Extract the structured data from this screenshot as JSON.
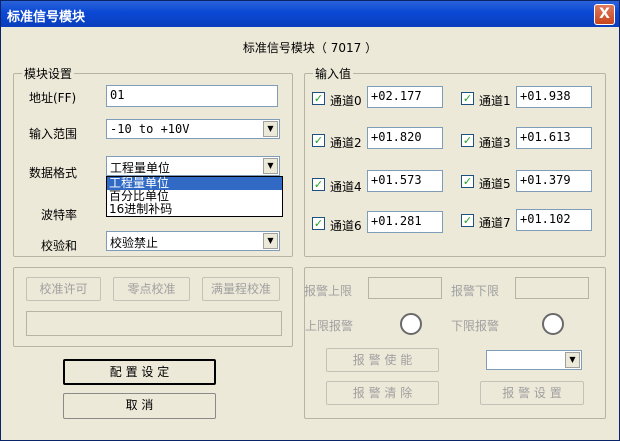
{
  "window": {
    "title": "标准信号模块",
    "close_glyph": "X"
  },
  "header": {
    "text": "标准信号模块（ 7017  ）"
  },
  "module_settings": {
    "legend": "模块设置",
    "address_label": "地址(FF)",
    "address_value": "01",
    "input_range_label": "输入范围",
    "input_range_value": "-10 to +10V",
    "data_format_label": "数据格式",
    "data_format_value": "工程量单位",
    "data_format_options": [
      "工程量单位",
      "百分比单位",
      "16进制补码"
    ],
    "baud_rate_label": "波特率",
    "checksum_label": "校验和",
    "checksum_value": "校验禁止"
  },
  "input_values": {
    "legend": "输入值",
    "channels": [
      {
        "label": "通道0",
        "value": "+02.177",
        "checked": true
      },
      {
        "label": "通道1",
        "value": "+01.938",
        "checked": true
      },
      {
        "label": "通道2",
        "value": "+01.820",
        "checked": true
      },
      {
        "label": "通道3",
        "value": "+01.613",
        "checked": true
      },
      {
        "label": "通道4",
        "value": "+01.573",
        "checked": true
      },
      {
        "label": "通道5",
        "value": "+01.379",
        "checked": true
      },
      {
        "label": "通道6",
        "value": "+01.281",
        "checked": true
      },
      {
        "label": "通道7",
        "value": "+01.102",
        "checked": true
      }
    ]
  },
  "calibration": {
    "calibrate_allow": "校准许可",
    "zero_calibrate": "零点校准",
    "full_scale_calibrate": "满量程校准"
  },
  "alarm": {
    "upper_limit_label": "报警上限",
    "lower_limit_label": "报警下限",
    "upper_alarm_label": "上限报警",
    "lower_alarm_label": "下限报警",
    "enable_button": "报 警 使 能",
    "clear_button": "报 警 清 除",
    "settings_button": "报 警 设 置"
  },
  "actions": {
    "config_button": "配 置 设 定",
    "cancel_button": "取  消"
  },
  "icons": {
    "dropdown": "chevron-down-icon",
    "check": "checkmark-icon"
  }
}
